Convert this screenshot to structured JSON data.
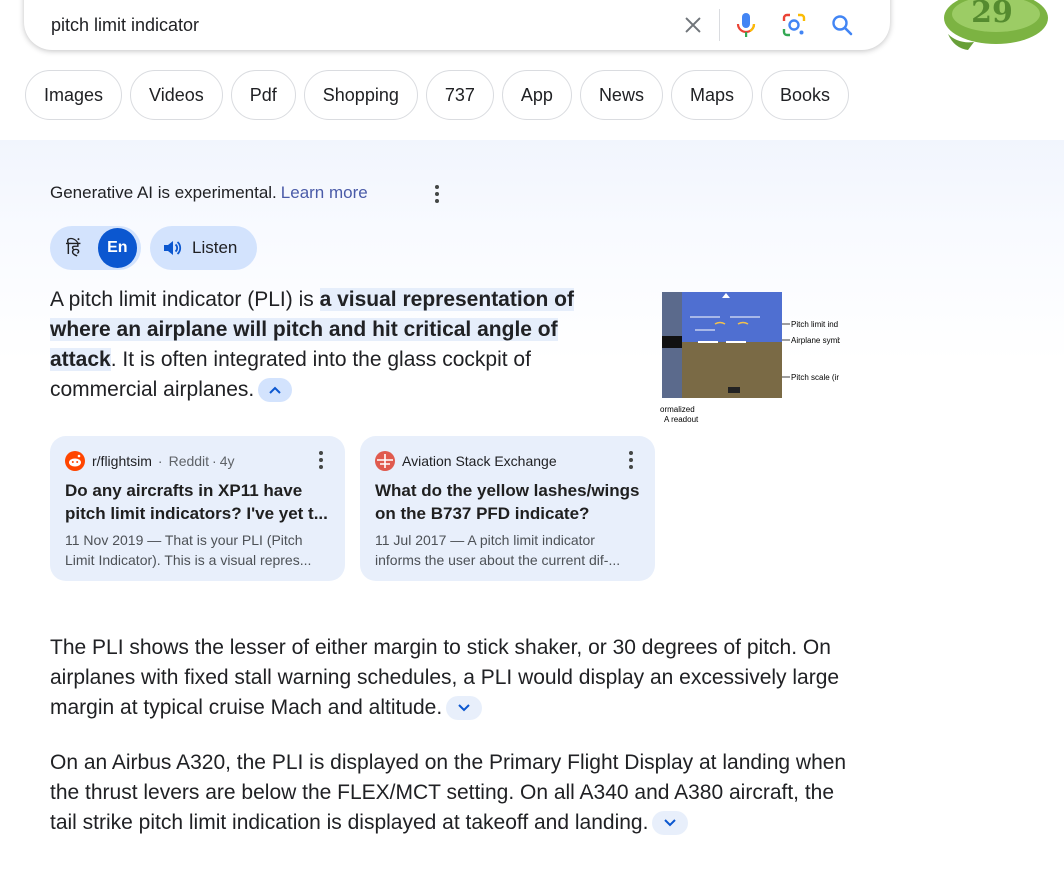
{
  "search": {
    "query": "pitch limit indicator",
    "clear_icon": "close-icon",
    "voice_icon": "mic-icon",
    "lens_icon": "lens-icon",
    "search_icon": "search-icon"
  },
  "doodle": {
    "number": "29"
  },
  "chips": [
    "Images",
    "Videos",
    "Pdf",
    "Shopping",
    "737",
    "App",
    "News",
    "Maps",
    "Books"
  ],
  "ai_overview": {
    "experimental_text": "Generative AI is experimental.",
    "learn_more": "Learn more",
    "lang_hindi": "हिं",
    "lang_english": "En",
    "listen_label": "Listen",
    "para1_start": "A pitch limit indicator (PLI) is ",
    "para1_highlight": "a visual representation of where an airplane will pitch and hit critical angle of attack",
    "para1_end": ". It is often integrated into the glass cockpit of commercial airplanes.",
    "thumbnail": {
      "labels": [
        "Pitch limit ind",
        "Airplane symb",
        "Pitch scale (ir",
        "ormalized",
        "A readout"
      ]
    },
    "sources": [
      {
        "name": "r/flightsim",
        "site": "Reddit",
        "age": "4y",
        "title": "Do any aircrafts in XP11 have pitch limit indicators? I've yet t...",
        "snippet": "11 Nov 2019 — That is your PLI (Pitch Limit Indicator). This is a visual repres..."
      },
      {
        "name": "Aviation Stack Exchange",
        "title": "What do the yellow lashes/wings on the B737 PFD indicate?",
        "snippet": "11 Jul 2017 — A pitch limit indicator informs the user about the current dif-..."
      }
    ],
    "para2": "The PLI shows the lesser of either margin to stick shaker, or 30 degrees of pitch. On airplanes with fixed stall warning schedules, a PLI would display an excessively large margin at typical cruise Mach and altitude.",
    "para3": "On an Airbus A320, the PLI is displayed on the Primary Flight Display at landing when the thrust levers are below the FLEX/MCT setting. On all A340 and A380 aircraft, the tail strike pitch limit indication is displayed at takeoff and landing."
  },
  "colors": {
    "accent": "#0b57d0",
    "chip_bg": "#d3e3fd",
    "card_bg": "#e8effb",
    "link": "#4a5ba8"
  }
}
